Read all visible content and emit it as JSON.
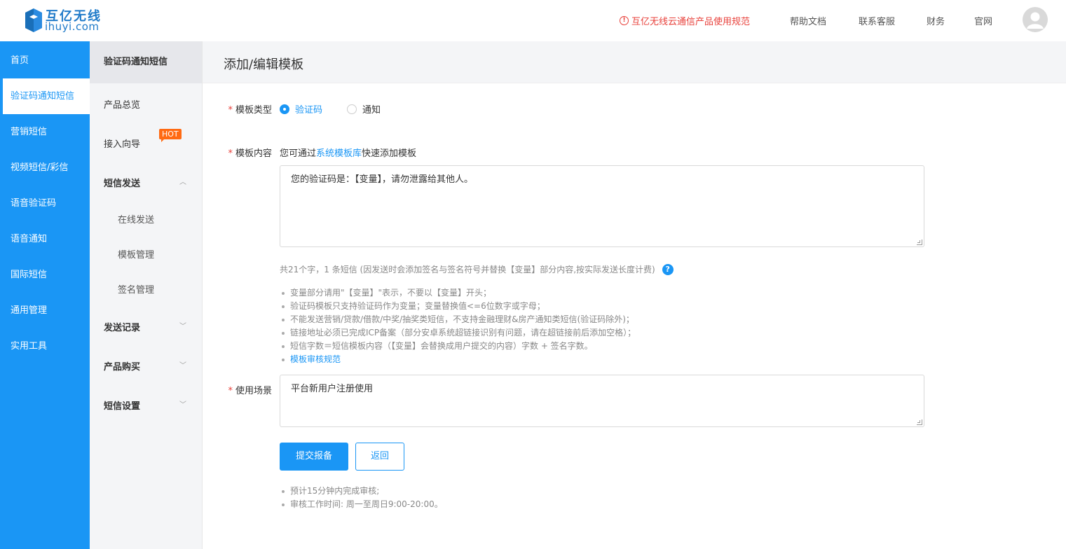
{
  "header": {
    "logo_title": "互亿无线",
    "logo_sub": "ihuyi.com",
    "notice": "互亿无线云通信产品使用规范",
    "links": [
      "帮助文档",
      "联系客服",
      "财务",
      "官网"
    ]
  },
  "primary_nav": {
    "items": [
      "首页",
      "验证码通知短信",
      "营销短信",
      "视频短信/彩信",
      "语音验证码",
      "语音通知",
      "国际短信",
      "通用管理",
      "实用工具"
    ],
    "active_index": 1
  },
  "secondary_nav": {
    "heading": "验证码通知短信",
    "overview": "产品总览",
    "guide": "接入向导",
    "hot_badge": "HOT",
    "send_group": "短信发送",
    "send_items": [
      "在线发送",
      "模板管理",
      "签名管理"
    ],
    "records": "发送记录",
    "purchase": "产品购买",
    "settings": "短信设置"
  },
  "page": {
    "title": "添加/编辑模板"
  },
  "form": {
    "required_mark": "*",
    "type_label": "模板类型",
    "type_options": [
      "验证码",
      "通知"
    ],
    "type_selected": "验证码",
    "content_label": "模板内容",
    "content_hint_prefix": "您可通过",
    "content_hint_link": "系统模板库",
    "content_hint_suffix": "快速添加模板",
    "content_value": "您的验证码是：【变量】，请勿泄露给其他人。",
    "count_text": "共21个字，1 条短信 (因发送时会添加签名与签名符号并替换【变量】部分内容,按实际发送长度计费)",
    "help_icon": "?",
    "rules": [
      "变量部分请用\"【变量】\"表示，不要以【变量】开头；",
      "验证码模板只支持验证码作为变量；变量替换值<=6位数字或字母；",
      "不能发送营销/贷款/借款/中奖/抽奖类短信，不支持金融理财&房产通知类短信(验证码除外)；",
      "链接地址必须已完成ICP备案（部分安卓系统超链接识别有问题，请在超链接前后添加空格）；",
      "短信字数＝短信模板内容（【变量】会替换成用户提交的内容）字数 + 签名字数。"
    ],
    "rules_link": "模板审核规范",
    "scene_label": "使用场景",
    "scene_value": "平台新用户注册使用",
    "submit_label": "提交报备",
    "back_label": "返回",
    "notes": [
      "预计15分钟内完成审核;",
      "审核工作时间: 周一至周日9:00-20:00。"
    ]
  },
  "colors": {
    "primary": "#1a96f5",
    "danger": "#e8413b",
    "hot": "#ff6a13"
  }
}
